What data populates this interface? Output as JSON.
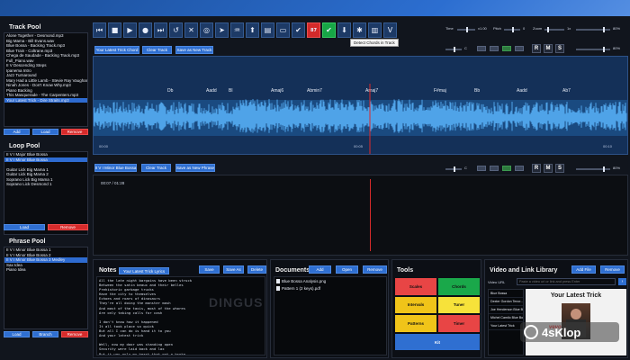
{
  "track_pool": {
    "title": "Track Pool",
    "items": [
      "Alone Together - Desmond.mp3",
      "Big Mama - Bill Evans.wav",
      "Blue Bossa - Backing Track.mp3",
      "Blue Train - Coltrane.mp3",
      "Chega de Saudade - Backing Track.mp3",
      "Full_Piano.wav",
      "II V Descending Steps",
      "Ipanema Intro",
      "Jazz Turnaround",
      "Mary Had a Little Lamb - Stevie Ray Vaughan.mp3",
      "Ninah Jones - Don't Know Why.mp3",
      "Piano Backing",
      "This Masquerade - The Carpenters.mp3",
      "Your Latest Trick - Dire Straits.mp3"
    ],
    "selected_index": 13,
    "add": "Add",
    "load": "Load",
    "remove": "Remove"
  },
  "loop_pool": {
    "title": "Loop Pool",
    "items": [
      "II V I Major Blue Bossa",
      "II V I Minor Blue Bossa",
      "",
      "Guitar Lick Big Mama 1",
      "Guitar Lick Big Mama 2",
      "Soprano Lick Big Mama 1",
      "Soprano Lick Desmond 1"
    ],
    "selected_index": 1,
    "load": "Load",
    "remove": "Remove"
  },
  "phrase_pool": {
    "title": "Phrase Pool",
    "items": [
      "II V I Minor Blue Bossa 1",
      "II V I Minor Blue Bossa 2",
      "II V I Minor Blue Bossa 3 Medley",
      "Sax Idea",
      "Piano Idea"
    ],
    "selected_index": 2,
    "load": "Load",
    "branch": "Branch",
    "remove": "Remove"
  },
  "toolbar": {
    "buttons": [
      {
        "icon": "skip-back-icon",
        "glyph": "⏮"
      },
      {
        "icon": "stop-icon",
        "glyph": "■"
      },
      {
        "icon": "play-icon",
        "glyph": "▶"
      },
      {
        "icon": "record-icon",
        "glyph": "●"
      },
      {
        "icon": "skip-forward-icon",
        "glyph": "⏭"
      },
      {
        "icon": "undo-icon",
        "glyph": "↺"
      },
      {
        "icon": "close-icon",
        "glyph": "✕"
      },
      {
        "icon": "target-icon",
        "glyph": "◎"
      },
      {
        "icon": "navigate-icon",
        "glyph": "➤"
      },
      {
        "icon": "waveform-icon",
        "glyph": "♒"
      },
      {
        "icon": "marker-icon",
        "glyph": "⬆"
      },
      {
        "icon": "piano-roll-icon",
        "glyph": "▤"
      },
      {
        "icon": "loop-icon",
        "glyph": "▭"
      },
      {
        "icon": "check-icon",
        "glyph": "✔"
      },
      {
        "icon": "chords-count-icon",
        "glyph": "87"
      },
      {
        "icon": "confirm-icon",
        "glyph": "✔"
      },
      {
        "icon": "download-icon",
        "glyph": "⬇"
      },
      {
        "icon": "asterisk-icon",
        "glyph": "✱"
      },
      {
        "icon": "keyboard-icon",
        "glyph": "▥"
      },
      {
        "icon": "voice-icon",
        "glyph": "V"
      }
    ],
    "tooltip": "Detect Chords in Track"
  },
  "controls": {
    "time_label": "Time",
    "time_value": "x1.00",
    "pitch_label": "Pitch",
    "pitch_value": "0",
    "zoom_label": "Zoom",
    "zoom_value": "1x",
    "vol_label": "C",
    "vol_value": "80%",
    "rms": [
      "R",
      "M",
      "S"
    ]
  },
  "track_editor": {
    "btn_save_latest": "Your Latest Trick Chord",
    "btn_clear": "Clear Track",
    "btn_save_new": "Save as New Track",
    "chords": [
      "Db",
      "Aadd",
      "Bl",
      "Amaj6",
      "Abmin7",
      "Amaj7",
      "F#maj",
      "Bb",
      "Aadd",
      "Ab7"
    ],
    "time_left": "00:00",
    "time_mid": "00:05",
    "time_right": "00:10"
  },
  "loop_editor": {
    "btn_title": "II V I Minor Blue Bossa",
    "btn_clear": "Clear Track",
    "btn_save_new": "Save as New Phrase",
    "position": "00:07 / 01:28"
  },
  "notes": {
    "title": "Notes",
    "select": "Your Latest Trick Lyrics",
    "save": "Save",
    "save_as": "Save As",
    "delete": "Delete",
    "lines": [
      "All the late night bargains have been struck",
      "Between the satin beaux and their belles",
      "Prehistoric garbage trucks",
      "Have the city to themselves",
      "Echoes and roars of dinosaurs",
      "They're all doing the monster mash",
      "And most of the taxis, most of the whores",
      "Are only taking calls for cash",
      "",
      "I don't know how it happened",
      "It all took place so quick",
      "But all I can do is hand it to you",
      "And your latest trick",
      "",
      "Well, now my door was standing open",
      "Security were laid back and lax",
      "But it was only my heart that got a-broke"
    ],
    "watermark": "DINGUS"
  },
  "documents": {
    "title": "Documents",
    "add": "Add",
    "open": "Open",
    "remove": "Remove",
    "items": [
      "Blue Bossa Analysis.png",
      "Pattern 1 (2 keys).pdf"
    ]
  },
  "tools": {
    "title": "Tools",
    "cells": [
      {
        "label": "Scales",
        "color": "#e84545"
      },
      {
        "label": "Chords",
        "color": "#1aa84a"
      },
      {
        "label": "Intervals",
        "color": "#f0c419"
      },
      {
        "label": "Tuner",
        "color": "#f7e23a"
      },
      {
        "label": "Patterns",
        "color": "#f0c419"
      },
      {
        "label": "Timer",
        "color": "#e84545"
      }
    ],
    "bottom": "Kit"
  },
  "video_library": {
    "title": "Video and Link Library",
    "add_file": "Add File",
    "remove": "Remove",
    "url_label": "Video URL",
    "url_placeholder": "Paste a video url or link and press Enter",
    "items": [
      "Blue Bossa",
      "Dexter Gordon Tenor...",
      "Joe Henderson Blue Bossa",
      "Michel Camilo Blue Bossa",
      "Your Latest Trick"
    ],
    "preview_title": "Your Latest Trick",
    "brand": "vevo"
  },
  "watermark": "4sKlop"
}
